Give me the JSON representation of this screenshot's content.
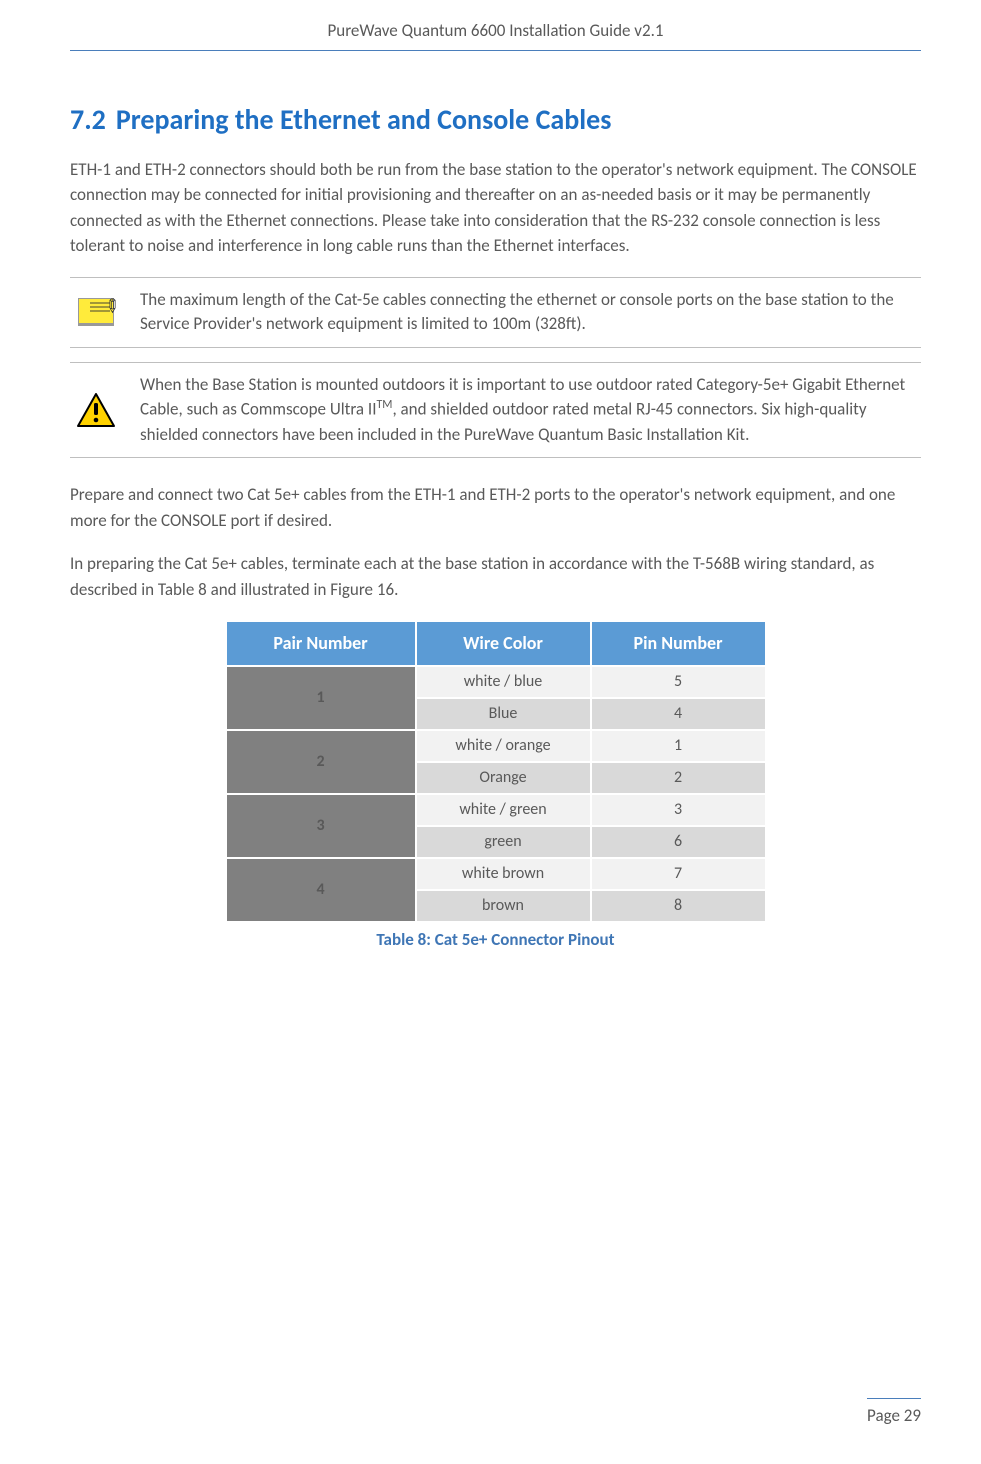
{
  "header": {
    "title": "PureWave Quantum 6600 Installation Guide v2.1"
  },
  "section": {
    "number": "7.2",
    "title": "Preparing the Ethernet and Console Cables"
  },
  "paragraphs": {
    "intro": "ETH-1 and ETH-2 connectors should both be run from the base station to the operator's network equipment.  The CONSOLE connection may be connected for initial provisioning and thereafter on an as-needed basis or it may be permanently connected as with the Ethernet connections.  Please take into consideration that the RS-232 console connection is less tolerant to noise and interference in long cable runs than the Ethernet interfaces.",
    "note1": "The maximum length of the Cat-5e cables connecting the ethernet or console ports on the base station to the Service Provider's network equipment is limited to 100m (328ft).",
    "note2_pre": "When the Base Station is mounted outdoors it is important to use outdoor rated Category-5e+ Gigabit Ethernet Cable, such as Commscope Ultra II",
    "note2_sup": "TM",
    "note2_post": ", and shielded outdoor rated metal RJ-45 connectors.  Six high-quality shielded connectors have been included in the PureWave Quantum Basic Installation Kit.",
    "p2": "Prepare and connect two Cat 5e+ cables from the ETH-1 and ETH-2 ports to the operator's network equipment, and one more for the CONSOLE port if desired.",
    "p3": "In preparing the Cat 5e+ cables, terminate each at the base station in accordance with the T-568B wiring standard, as described in Table 8 and illustrated in Figure 16."
  },
  "table": {
    "headers": {
      "pair": "Pair Number",
      "wire": "Wire Color",
      "pin": "Pin Number"
    },
    "rows": [
      {
        "pair": "1",
        "wire_a": "white / blue",
        "pin_a": "5",
        "wire_b": "Blue",
        "pin_b": "4"
      },
      {
        "pair": "2",
        "wire_a": "white / orange",
        "pin_a": "1",
        "wire_b": "Orange",
        "pin_b": "2"
      },
      {
        "pair": "3",
        "wire_a": "white / green",
        "pin_a": "3",
        "wire_b": "green",
        "pin_b": "6"
      },
      {
        "pair": "4",
        "wire_a": "white brown",
        "pin_a": "7",
        "wire_b": "brown",
        "pin_b": "8"
      }
    ],
    "caption": "Table 8: Cat 5e+ Connector Pinout"
  },
  "footer": {
    "page": "Page 29"
  }
}
